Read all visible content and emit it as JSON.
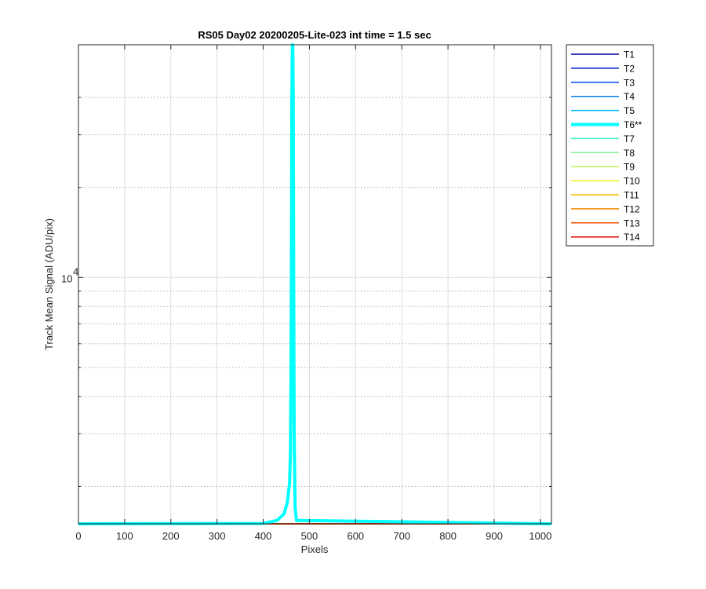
{
  "chart_data": {
    "type": "line",
    "title": "RS05 Day02 20200205-Lite-023 int time = 1.5 sec",
    "xlabel": "Pixels",
    "ylabel": "Track Mean Signal (ADU/pix)",
    "xlim": [
      0,
      1024
    ],
    "ylim": [
      1500,
      60000
    ],
    "yscale": "log",
    "x_ticks": [
      0,
      100,
      200,
      300,
      400,
      500,
      600,
      700,
      800,
      900,
      1000
    ],
    "x_tick_labels": [
      "0",
      "100",
      "200",
      "300",
      "400",
      "500",
      "600",
      "700",
      "800",
      "900",
      "1000"
    ],
    "y_ticks": [
      10000
    ],
    "y_tick_labels": [
      "10",
      "4"
    ],
    "y_minor_ticks": [
      2000,
      3000,
      4000,
      5000,
      6000,
      7000,
      8000,
      9000,
      20000,
      30000,
      40000
    ],
    "grid": true,
    "legend_position": "outside-right",
    "baseline_value": 1500,
    "series": [
      {
        "name": "T1",
        "color": "#0000a6",
        "width": 1.5,
        "x": [
          0,
          1024
        ],
        "y": [
          1500,
          1500
        ]
      },
      {
        "name": "T2",
        "color": "#0018d9",
        "width": 1.5,
        "x": [
          0,
          1024
        ],
        "y": [
          1500,
          1500
        ]
      },
      {
        "name": "T3",
        "color": "#0048f2",
        "width": 1.5,
        "x": [
          0,
          1024
        ],
        "y": [
          1500,
          1500
        ]
      },
      {
        "name": "T4",
        "color": "#0080f0",
        "width": 1.5,
        "x": [
          0,
          1024
        ],
        "y": [
          1500,
          1500
        ]
      },
      {
        "name": "T5",
        "color": "#00b8f5",
        "width": 1.5,
        "x": [
          0,
          1024
        ],
        "y": [
          1500,
          1500
        ]
      },
      {
        "name": "T6**",
        "color": "#00ffff",
        "width": 4,
        "x": [
          0,
          400,
          430,
          445,
          452,
          457,
          459,
          460,
          461,
          462,
          463,
          464,
          465,
          466,
          467,
          469,
          472,
          1024
        ],
        "y": [
          1500,
          1505,
          1540,
          1620,
          1760,
          2050,
          2600,
          4500,
          12000,
          40000,
          60000,
          60000,
          40000,
          9000,
          3000,
          1700,
          1540,
          1500
        ]
      },
      {
        "name": "T7",
        "color": "#40f0c8",
        "width": 1.5,
        "x": [
          0,
          1024
        ],
        "y": [
          1500,
          1500
        ]
      },
      {
        "name": "T8",
        "color": "#80f598",
        "width": 1.5,
        "x": [
          0,
          1024
        ],
        "y": [
          1500,
          1500
        ]
      },
      {
        "name": "T9",
        "color": "#b8f560",
        "width": 1.5,
        "x": [
          0,
          1024
        ],
        "y": [
          1500,
          1500
        ]
      },
      {
        "name": "T10",
        "color": "#f0f020",
        "width": 1.5,
        "x": [
          0,
          1024
        ],
        "y": [
          1500,
          1500
        ]
      },
      {
        "name": "T11",
        "color": "#f2c000",
        "width": 1.5,
        "x": [
          0,
          1024
        ],
        "y": [
          1500,
          1500
        ]
      },
      {
        "name": "T12",
        "color": "#f58a00",
        "width": 1.5,
        "x": [
          0,
          1024
        ],
        "y": [
          1500,
          1500
        ]
      },
      {
        "name": "T13",
        "color": "#f25000",
        "width": 1.5,
        "x": [
          0,
          1024
        ],
        "y": [
          1500,
          1500
        ]
      },
      {
        "name": "T14",
        "color": "#d90000",
        "width": 1.5,
        "x": [
          0,
          1024
        ],
        "y": [
          1500,
          1500
        ]
      }
    ]
  }
}
